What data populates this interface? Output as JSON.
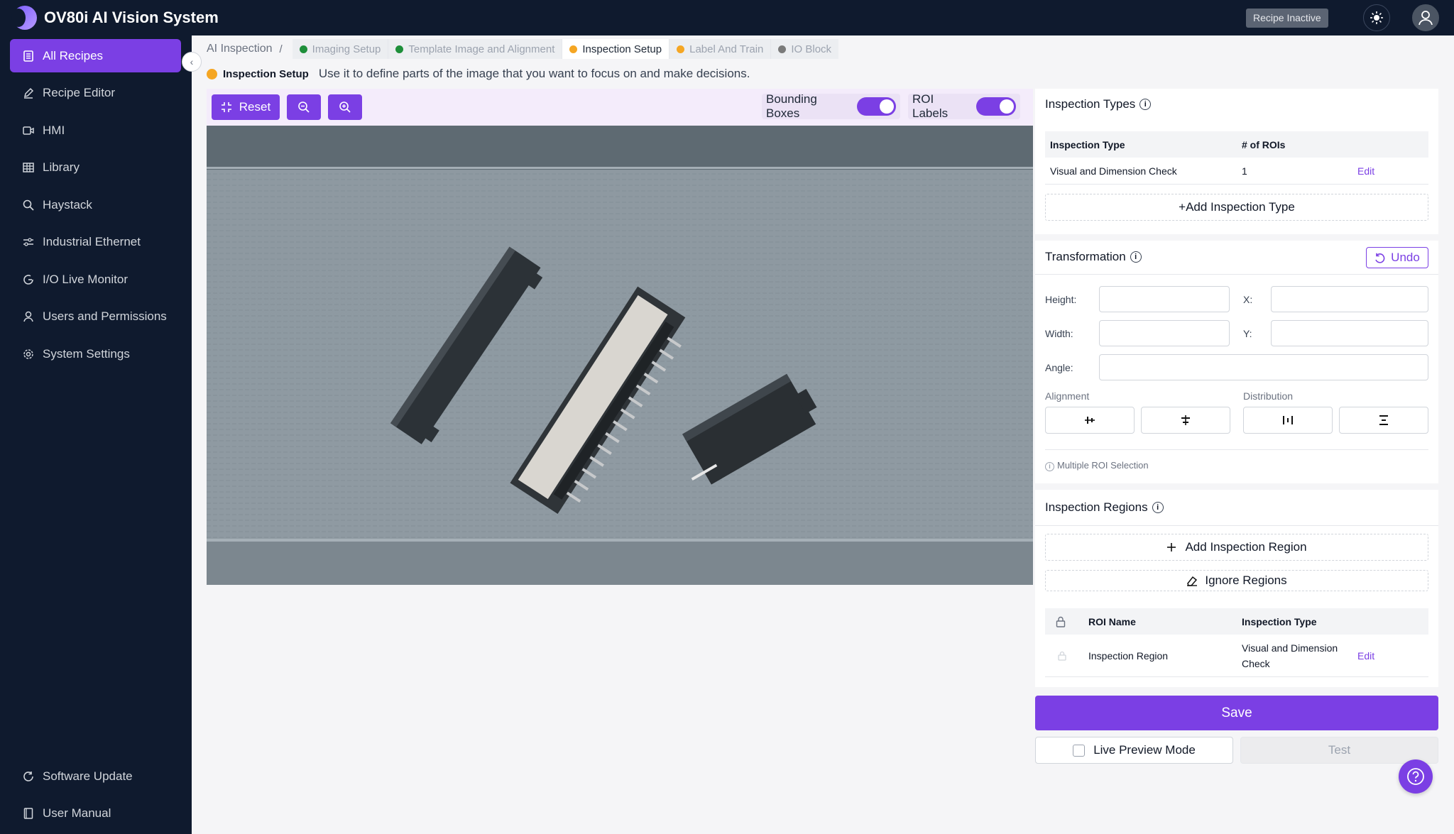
{
  "app": {
    "title": "OV80i AI Vision System",
    "status": "Recipe Inactive"
  },
  "sidebar": {
    "items": [
      {
        "label": "All Recipes",
        "icon": "document-icon"
      },
      {
        "label": "Recipe Editor",
        "icon": "pencil-icon"
      },
      {
        "label": "HMI",
        "icon": "camera-icon"
      },
      {
        "label": "Library",
        "icon": "grid-icon"
      },
      {
        "label": "Haystack",
        "icon": "search-icon"
      },
      {
        "label": "Industrial Ethernet",
        "icon": "network-icon"
      },
      {
        "label": "I/O Live Monitor",
        "icon": "gauge-icon"
      },
      {
        "label": "Users and Permissions",
        "icon": "user-icon"
      },
      {
        "label": "System Settings",
        "icon": "gear-icon"
      }
    ],
    "bottom": [
      {
        "label": "Software Update",
        "icon": "refresh-icon"
      },
      {
        "label": "User Manual",
        "icon": "book-icon"
      }
    ]
  },
  "breadcrumb": {
    "root": "AI Inspection",
    "sep": "/",
    "steps": [
      {
        "label": "Imaging Setup",
        "color": "#1e8f3a"
      },
      {
        "label": "Template Image and Alignment",
        "color": "#1e8f3a"
      },
      {
        "label": "Inspection Setup",
        "color": "#f5a623"
      },
      {
        "label": "Label And Train",
        "color": "#f5a623"
      },
      {
        "label": "IO Block",
        "color": "#7a7a7a"
      }
    ]
  },
  "hint": {
    "title": "Inspection Setup",
    "text": "Use it to define parts of the image that you want to focus on and make decisions."
  },
  "toolbar": {
    "reset": "Reset",
    "bounding_boxes": "Bounding Boxes",
    "roi_labels": "ROI Labels"
  },
  "inspection_types": {
    "title": "Inspection Types",
    "headers": [
      "Inspection Type",
      "# of ROIs"
    ],
    "rows": [
      {
        "type": "Visual and Dimension Check",
        "rois": "1",
        "action": "Edit"
      }
    ],
    "add": "+Add Inspection Type"
  },
  "transformation": {
    "title": "Transformation",
    "undo": "Undo",
    "height": "Height:",
    "width": "Width:",
    "x": "X:",
    "y": "Y:",
    "angle": "Angle:",
    "alignment": "Alignment",
    "distribution": "Distribution",
    "multi_note": "Multiple ROI Selection"
  },
  "inspection_regions": {
    "title": "Inspection Regions",
    "add": "Add Inspection Region",
    "ignore": "Ignore Regions",
    "headers": [
      "ROI Name",
      "Inspection Type"
    ],
    "rows": [
      {
        "name": "Inspection Region",
        "type_line1": "Visual and Dimension",
        "type_line2": "Check",
        "action": "Edit"
      }
    ]
  },
  "actions": {
    "save": "Save",
    "live_preview": "Live Preview Mode",
    "test": "Test"
  },
  "colors": {
    "accent": "#7b3fe4",
    "sidebar": "#0f1a2e"
  }
}
